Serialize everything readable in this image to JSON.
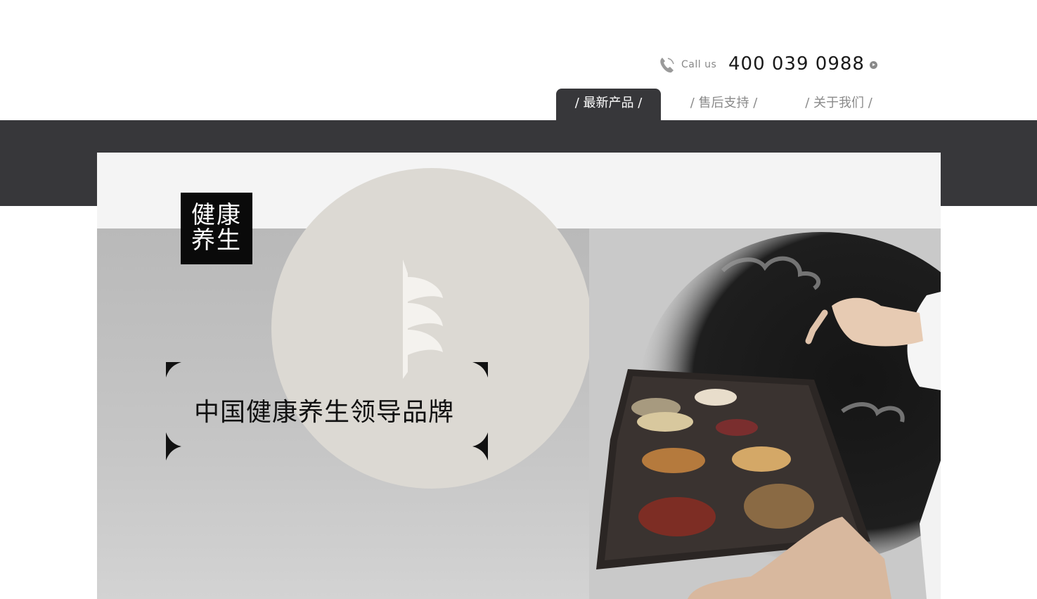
{
  "header": {
    "call_label": "Call us",
    "phone": "400 039 0988"
  },
  "nav": {
    "items": [
      {
        "label": "/ 最新产品 /",
        "active": true
      },
      {
        "label": "/ 售后支持 /",
        "active": false
      },
      {
        "label": "/ 关于我们 /",
        "active": false
      }
    ]
  },
  "hero": {
    "logo_line1": "健康",
    "logo_line2": "养生",
    "slogan": "中国健康养生领导品牌"
  },
  "colors": {
    "dark_band": "#37373a",
    "accent_circle": "#dcd9d3",
    "logo_bg": "#0a0a0a"
  }
}
